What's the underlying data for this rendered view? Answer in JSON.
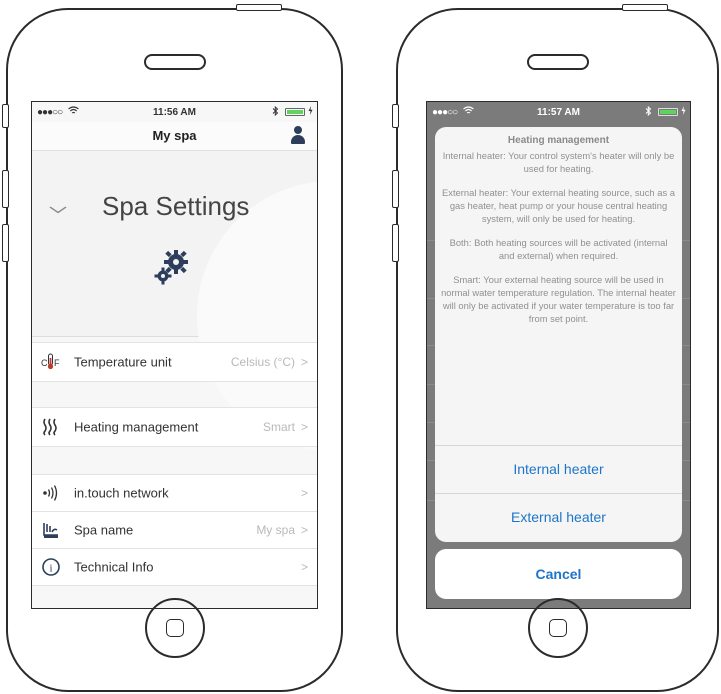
{
  "left_screen": {
    "status_bar": {
      "carrier": "●●●○○",
      "time": "11:56 AM"
    },
    "nav_bar": {
      "title": "My spa"
    },
    "header": {
      "title": "Spa Settings"
    },
    "rows": [
      {
        "label": "Temperature unit",
        "value": "Celsius (°C)",
        "chevron": ">"
      },
      {
        "label": "Heating management",
        "value": "Smart",
        "chevron": ">"
      },
      {
        "label": "in.touch network",
        "value": "",
        "chevron": ">"
      },
      {
        "label": "Spa name",
        "value": "My spa",
        "chevron": ">"
      },
      {
        "label": "Technical Info",
        "value": "",
        "chevron": ">"
      }
    ],
    "icon_text": {
      "temp_c": "C",
      "temp_f": "F",
      "info": "i"
    }
  },
  "right_screen": {
    "status_bar": {
      "carrier": "●●●○○",
      "time": "11:57 AM"
    },
    "action_sheet": {
      "title": "Heating management",
      "paragraphs": [
        "Internal heater: Your control system's heater will only be used for heating.",
        "External heater: Your external heating source, such as a gas heater, heat pump or your house central heating system, will only be used for heating.",
        "Both: Both heating sources will be activated (internal and external) when required.",
        "Smart: Your external heating source will be used in normal water temperature regulation.  The internal heater will only be activated if your water temperature is too far from set point."
      ],
      "actions": [
        "Internal heater",
        "External heater"
      ],
      "cancel": "Cancel"
    }
  },
  "colors": {
    "accent": "#1d75c9",
    "battery": "#5fd35f",
    "profile": "#2c3e5b",
    "muted": "#b9b9b9"
  }
}
